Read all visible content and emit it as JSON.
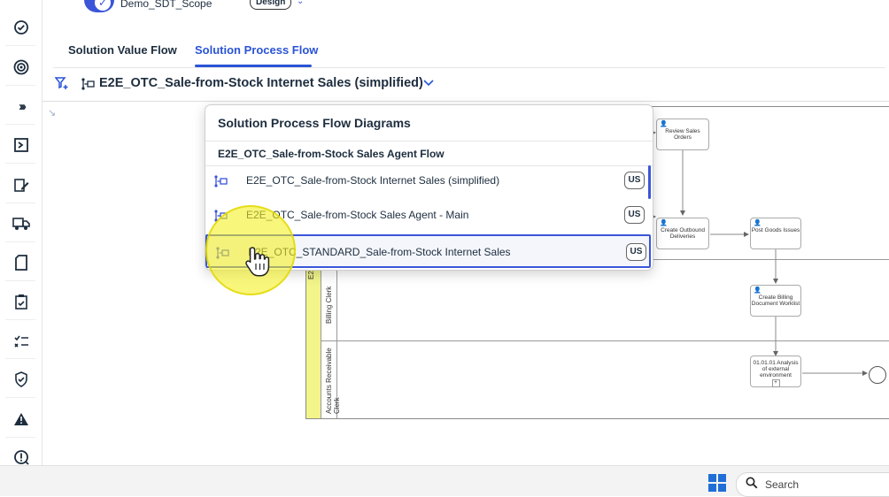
{
  "scope": {
    "name": "Demo_SDT_Scope",
    "mode_badge": "Design"
  },
  "tabs": [
    {
      "label": "Solution Value Flow",
      "active": false
    },
    {
      "label": "Solution Process Flow",
      "active": true
    }
  ],
  "toolbar": {
    "diagram_title": "E2E_OTC_Sale-from-Stock Internet Sales (simplified)"
  },
  "rail_icons": [
    "check-badge-icon",
    "target-icon",
    "chevron-double-right-icon",
    "process-box-icon",
    "edit-form-icon",
    "truck-icon",
    "document-icon",
    "clipboard-check-icon",
    "task-list-icon",
    "shield-check-icon",
    "warning-icon",
    "alert-circle-icon"
  ],
  "popover": {
    "title": "Solution Process Flow Diagrams",
    "group_label": "E2E_OTC_Sale-from-Stock Sales Agent Flow",
    "items": [
      {
        "label": "E2E_OTC_Sale-from-Stock Internet Sales (simplified)",
        "badge": "US",
        "selected": false
      },
      {
        "label": "E2E_OTC_Sale-from-Stock Sales Agent - Main",
        "badge": "US",
        "selected": false
      },
      {
        "label": "E2E_OTC_STANDARD_Sale-from-Stock Internet Sales",
        "badge": "US",
        "selected": true
      }
    ]
  },
  "diagram": {
    "pool_label": "E2E_OTC_Sale-fr",
    "lanes": [
      "Billing Clerk",
      "Accounts Receivable Clerk"
    ],
    "tasks": {
      "review_sales_orders": "Review Sales Orders",
      "create_outbound_deliveries": "Create Outbound Deliveries",
      "post_goods_issues": "Post Goods Issues",
      "create_billing_worklist": "Create Billing Document Worklist",
      "analysis_external": "01.01.01 Analysis of external environment"
    }
  },
  "taskbar": {
    "search_label": "Search"
  },
  "colors": {
    "accent": "#2a54d6",
    "pool": "#f2f58a",
    "highlight": "#f5f01e"
  }
}
